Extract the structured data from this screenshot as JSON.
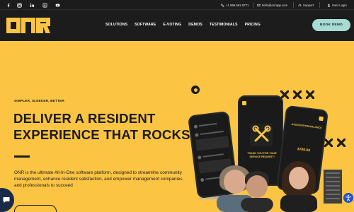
{
  "topbar": {
    "social_icons": [
      "facebook-icon",
      "instagram-icon",
      "linkedin-icon",
      "google-my-business-icon",
      "youtube-icon"
    ],
    "phone": "+1 866.562.9771",
    "email": "hello@onrapp.com",
    "support_label": "Support",
    "login_label": "User Login"
  },
  "nav": {
    "logo_text": "ONR",
    "items": [
      "SOLUTIONS",
      "SOFTWARE",
      "E-VOTING",
      "DEMOS",
      "TESTIMONIALS",
      "PRICING"
    ],
    "cta_label": "BOOK DEMO"
  },
  "hero": {
    "eyebrow": "SIMPLER, SLEEKER, BETTER",
    "headline": "DELIVER A RESIDENT EXPERIENCE THAT ROCKS",
    "body": "ONR is the ultimate All-In-One software platform, designed to streamline community management, enhance resident satisfaction, and empower management companies and professionals to succeed"
  },
  "illustration": {
    "thank_you_text": "THANK YOU FOR YOUR SERVICE REQUEST!",
    "association_text": "ASSOCIATION BALANCE",
    "balance_text": "$780.00"
  },
  "colors": {
    "accent_yellow": "#fbc443",
    "dark": "#1c1c1c",
    "cta_mint": "#a6dcd3"
  }
}
